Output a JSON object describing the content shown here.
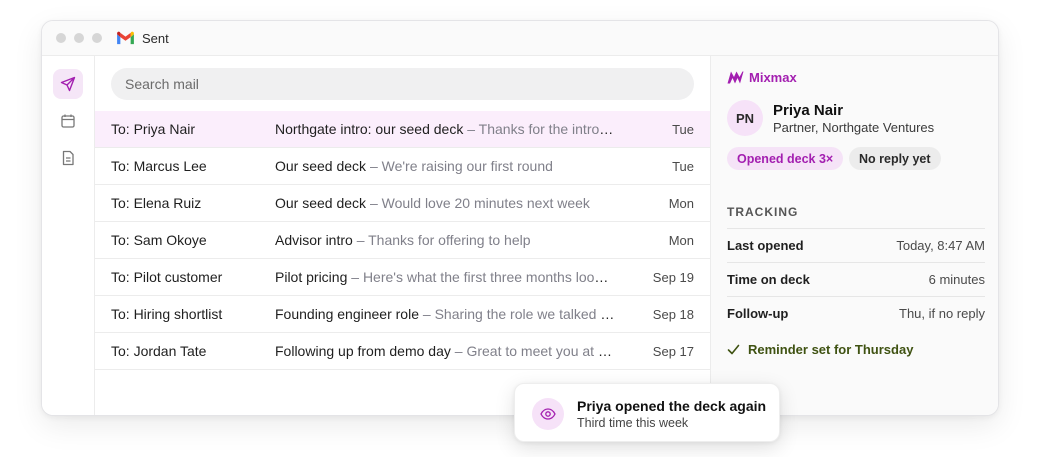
{
  "window": {
    "title": "Sent"
  },
  "icons": {
    "gmail": "gmail-logo",
    "rail": [
      "send-icon",
      "calendar-icon",
      "document-icon"
    ],
    "check": "check-icon",
    "eye": "eye-icon"
  },
  "colors": {
    "accent": "#a31fb0",
    "selected_row": "#fbeefc",
    "reminder": "#3f5212"
  },
  "search": {
    "placeholder": "Search mail"
  },
  "emails": [
    {
      "to": "To: Priya Nair",
      "subject": "Northgate intro: our seed deck",
      "preview": " – Thanks for the intro …",
      "date": "Tue"
    },
    {
      "to": "To: Marcus Lee",
      "subject": "Our seed deck",
      "preview": " – We're raising our first round",
      "date": "Tue"
    },
    {
      "to": "To: Elena Ruiz",
      "subject": "Our seed deck",
      "preview": " – Would love 20 minutes next week",
      "date": "Mon"
    },
    {
      "to": "To: Sam Okoye",
      "subject": "Advisor intro",
      "preview": " – Thanks for offering to help",
      "date": "Mon"
    },
    {
      "to": "To: Pilot customer",
      "subject": "Pilot pricing",
      "preview": " – Here's what the first three months look…",
      "date": "Sep 19"
    },
    {
      "to": "To: Hiring shortlist",
      "subject": "Founding engineer role",
      "preview": " – Sharing the role we talked a…",
      "date": "Sep 18"
    },
    {
      "to": "To: Jordan Tate",
      "subject": "Following up from demo day",
      "preview": " – Great to meet you at t…",
      "date": "Sep 17"
    }
  ],
  "panel": {
    "brand": "Mixmax",
    "contact": {
      "initials": "PN",
      "name": "Priya Nair",
      "role": "Partner, Northgate Ventures"
    },
    "pills": {
      "opened": "Opened deck 3×",
      "status": "No reply yet"
    },
    "tracking": {
      "title": "TRACKING",
      "rows": [
        {
          "label": "Last opened",
          "value": "Today, 8:47 AM"
        },
        {
          "label": "Time on deck",
          "value": "6 minutes"
        },
        {
          "label": "Follow-up",
          "value": "Thu, if no reply"
        }
      ]
    },
    "reminder": "Reminder set for Thursday"
  },
  "toast": {
    "title": "Priya opened the deck again",
    "subtitle": "Third time this week"
  }
}
